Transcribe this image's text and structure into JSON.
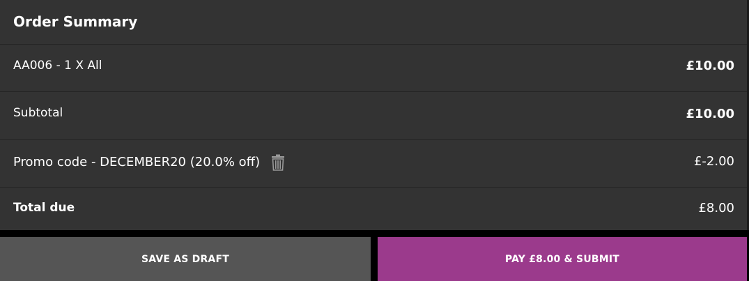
{
  "summary": {
    "title": "Order Summary",
    "items": [
      {
        "label": "AA006 - 1 X All",
        "amount": "£10.00"
      }
    ],
    "subtotal": {
      "label": "Subtotal",
      "amount": "£10.00"
    },
    "promo": {
      "label": "Promo code - DECEMBER20 (20.0% off)",
      "amount": "£-2.00",
      "remove_icon": "trash-icon"
    },
    "total": {
      "label": "Total due",
      "amount": "£8.00"
    }
  },
  "actions": {
    "save_draft_label": "SAVE AS DRAFT",
    "pay_label": "PAY £8.00 & SUBMIT"
  },
  "colors": {
    "panel_bg": "#333333",
    "draft_button": "#555555",
    "pay_button": "#9b3a8c",
    "icon_gray": "#9a9a9a"
  }
}
